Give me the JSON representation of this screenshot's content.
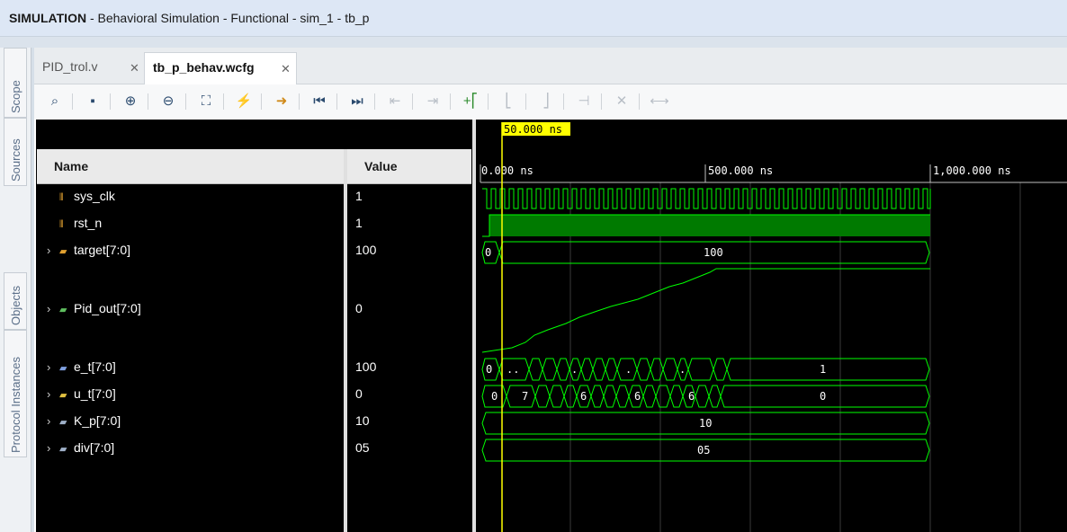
{
  "title": {
    "mode": "SIMULATION",
    "rest": " - Behavioral Simulation - Functional - sim_1 - tb_p"
  },
  "side_tabs": [
    "Scope",
    "Sources",
    "Objects",
    "Protocol Instances"
  ],
  "tabs": [
    {
      "label": "PID_trol.v"
    },
    {
      "label": "tb_p_behav.wcfg"
    }
  ],
  "toolbar": {
    "icons": [
      "search-icon",
      "save-icon",
      "zoom-in-icon",
      "zoom-out-icon",
      "zoom-fit-icon",
      "cursor-marker-icon",
      "go-to-cursor-icon",
      "go-to-start-icon",
      "go-to-end-icon",
      "previous-transition-icon",
      "next-transition-icon",
      "add-marker-icon",
      "previous-marker-icon",
      "next-marker-icon",
      "swap-cursors-icon",
      "delete-marker-icon",
      "snap-icon"
    ]
  },
  "columns": {
    "name": "Name",
    "value": "Value"
  },
  "signals": [
    {
      "name": "sys_clk",
      "value": "1"
    },
    {
      "name": "rst_n",
      "value": "1"
    },
    {
      "name": "target[7:0]",
      "value": "100"
    },
    {
      "name": "Pid_out[7:0]",
      "value": "0"
    },
    {
      "name": "e_t[7:0]",
      "value": "100"
    },
    {
      "name": "u_t[7:0]",
      "value": "0"
    },
    {
      "name": "K_p[7:0]",
      "value": "10"
    },
    {
      "name": "div[7:0]",
      "value": "05"
    }
  ],
  "waveform": {
    "cursor_label": "50.000 ns",
    "ruler": [
      "0.000 ns",
      "500.000 ns",
      "1,000.000 ns"
    ],
    "target_vals": [
      "0",
      "100"
    ],
    "e_t_vals": [
      "0",
      "..",
      ".",
      ".",
      ".",
      "1"
    ],
    "u_t_vals": [
      "0",
      "7",
      "6",
      "6",
      "6",
      "0"
    ],
    "k_p_val": "10",
    "div_val": "05",
    "colors": {
      "wave": "#00ff00",
      "cursor": "#ffff00",
      "fill": "#008000",
      "grid": "#404040"
    }
  }
}
